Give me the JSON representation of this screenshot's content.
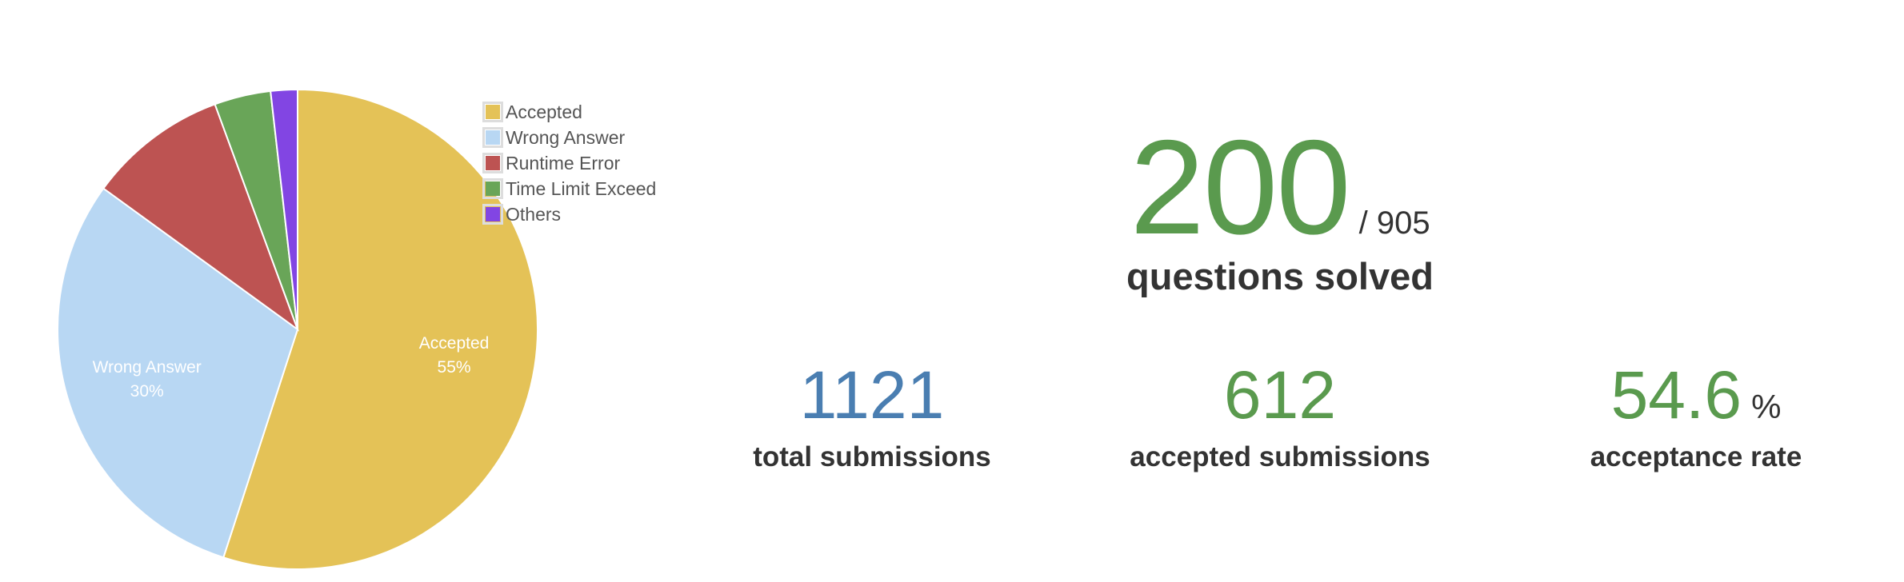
{
  "chart_data": {
    "type": "pie",
    "categories": [
      "Accepted",
      "Wrong Answer",
      "Runtime Error",
      "Time Limit Exceed",
      "Others"
    ],
    "values": [
      55,
      30,
      9.4,
      3.8,
      1.8
    ],
    "colors": [
      "#e4c257",
      "#b8d7f3",
      "#bd5352",
      "#69a558",
      "#8245e3"
    ],
    "slice_labels": [
      {
        "name": "Accepted",
        "pct": "55%"
      },
      {
        "name": "Wrong Answer",
        "pct": "30%"
      }
    ],
    "legend_position": "top-right"
  },
  "stats": {
    "solved": "200",
    "total_questions": "/ 905",
    "solved_label": "questions solved",
    "total_submissions": "1121",
    "total_submissions_label": "total submissions",
    "accepted_submissions": "612",
    "accepted_submissions_label": "accepted submissions",
    "acceptance_rate": "54.6",
    "acceptance_rate_unit": "%",
    "acceptance_rate_label": "acceptance rate"
  }
}
